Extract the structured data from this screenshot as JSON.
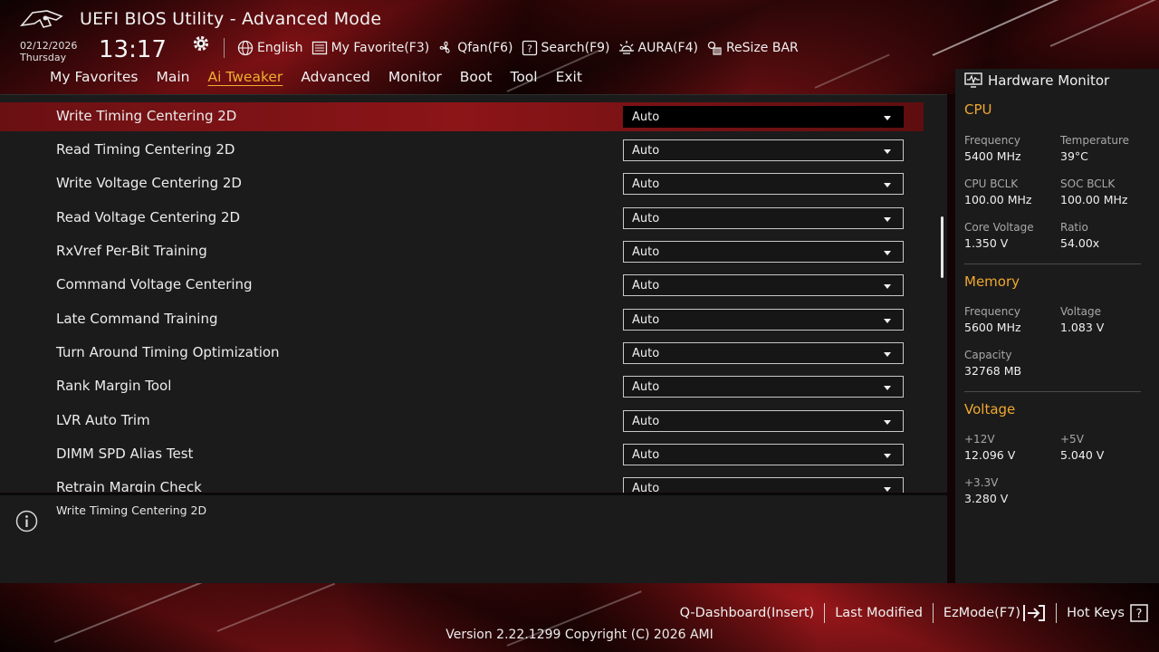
{
  "header": {
    "title": "UEFI BIOS Utility - Advanced Mode",
    "date": "02/12/2026",
    "day": "Thursday",
    "time": "13:17"
  },
  "toolbar": [
    {
      "label": "English",
      "icon": "globe-icon"
    },
    {
      "label": "My Favorite(F3)",
      "icon": "favorite-icon"
    },
    {
      "label": "Qfan(F6)",
      "icon": "fan-icon"
    },
    {
      "label": "Search(F9)",
      "icon": "search-icon"
    },
    {
      "label": "AURA(F4)",
      "icon": "aura-icon"
    },
    {
      "label": "ReSize BAR",
      "icon": "resize-bar-icon"
    }
  ],
  "tabs": [
    {
      "label": "My Favorites",
      "active": false
    },
    {
      "label": "Main",
      "active": false
    },
    {
      "label": "Ai Tweaker",
      "active": true
    },
    {
      "label": "Advanced",
      "active": false
    },
    {
      "label": "Monitor",
      "active": false
    },
    {
      "label": "Boot",
      "active": false
    },
    {
      "label": "Tool",
      "active": false
    },
    {
      "label": "Exit",
      "active": false
    }
  ],
  "settings": [
    {
      "label": "Write Timing Centering 2D",
      "value": "Auto",
      "selected": true
    },
    {
      "label": "Read Timing Centering 2D",
      "value": "Auto"
    },
    {
      "label": "Write Voltage Centering 2D",
      "value": "Auto"
    },
    {
      "label": "Read Voltage Centering 2D",
      "value": "Auto"
    },
    {
      "label": "RxVref Per-Bit Training",
      "value": "Auto"
    },
    {
      "label": "Command Voltage Centering",
      "value": "Auto"
    },
    {
      "label": "Late Command Training",
      "value": "Auto"
    },
    {
      "label": "Turn Around Timing Optimization",
      "value": "Auto"
    },
    {
      "label": "Rank Margin Tool",
      "value": "Auto"
    },
    {
      "label": "LVR Auto Trim",
      "value": "Auto"
    },
    {
      "label": "DIMM SPD Alias Test",
      "value": "Auto"
    },
    {
      "label": "Retrain Margin Check",
      "value": "Auto"
    }
  ],
  "help": {
    "text": "Write Timing Centering 2D"
  },
  "hardware_monitor": {
    "title": "Hardware Monitor",
    "cpu": {
      "heading": "CPU",
      "frequency_label": "Frequency",
      "frequency": "5400 MHz",
      "temperature_label": "Temperature",
      "temperature": "39°C",
      "cpu_bclk_label": "CPU BCLK",
      "cpu_bclk": "100.00 MHz",
      "soc_bclk_label": "SOC BCLK",
      "soc_bclk": "100.00 MHz",
      "core_voltage_label": "Core Voltage",
      "core_voltage": "1.350 V",
      "ratio_label": "Ratio",
      "ratio": "54.00x"
    },
    "memory": {
      "heading": "Memory",
      "frequency_label": "Frequency",
      "frequency": "5600 MHz",
      "voltage_label": "Voltage",
      "voltage": "1.083 V",
      "capacity_label": "Capacity",
      "capacity": "32768 MB"
    },
    "voltage": {
      "heading": "Voltage",
      "v12_label": "+12V",
      "v12": "12.096 V",
      "v5_label": "+5V",
      "v5": "5.040 V",
      "v33_label": "+3.3V",
      "v33": "3.280 V"
    }
  },
  "footer": {
    "q_dashboard": "Q-Dashboard(Insert)",
    "last_modified": "Last Modified",
    "ezmode": "EzMode(F7)",
    "hot_keys": "Hot Keys",
    "version": "Version 2.22.1299 Copyright (C) 2026 AMI"
  },
  "colors": {
    "accent": "#f0a830",
    "selected_row": "#8c1518",
    "panel": "#1b1b1b"
  }
}
